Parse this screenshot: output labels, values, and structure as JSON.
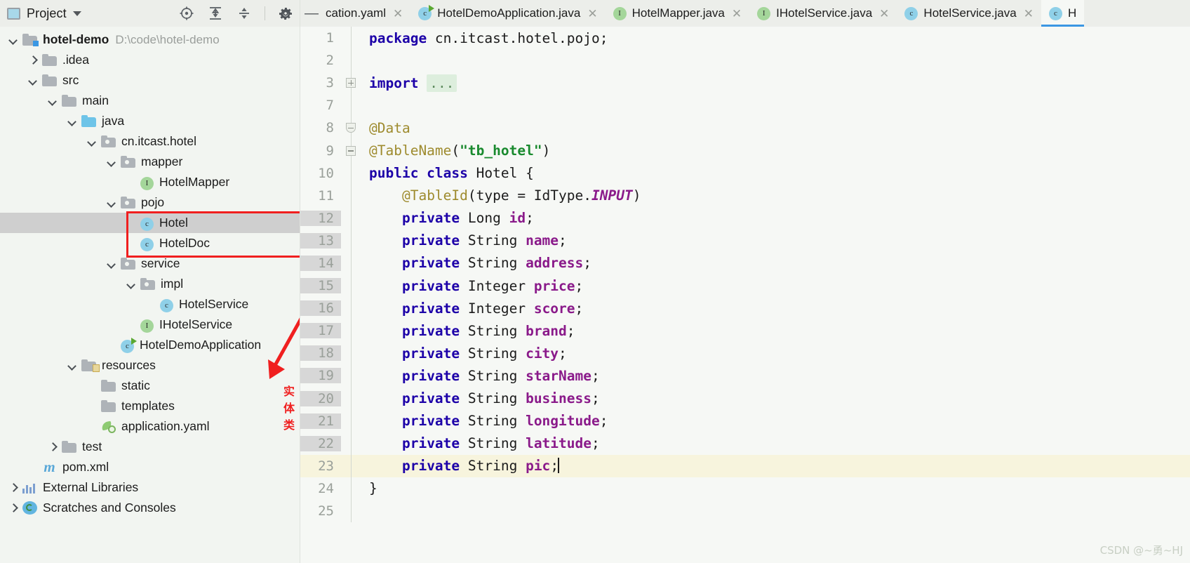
{
  "toolwindow": {
    "title": "Project",
    "icons": [
      "project-icon",
      "chevron-down-icon",
      "locate-icon",
      "expand-all-icon",
      "collapse-all-icon",
      "gear-icon",
      "minimize-icon"
    ]
  },
  "tabs": [
    {
      "label": "cation.yaml",
      "icon": "none",
      "active": false,
      "truncated": true
    },
    {
      "label": "HotelDemoApplication.java",
      "icon": "spring-class-icon",
      "active": false
    },
    {
      "label": "HotelMapper.java",
      "icon": "interface-icon",
      "active": false
    },
    {
      "label": "IHotelService.java",
      "icon": "interface-icon",
      "active": false
    },
    {
      "label": "HotelService.java",
      "icon": "class-icon",
      "active": false
    },
    {
      "label": "H",
      "icon": "class-icon",
      "active": true,
      "truncated": true
    }
  ],
  "tree": [
    {
      "indent": 0,
      "arrow": "down",
      "icon": "module-folder",
      "label": "hotel-demo",
      "bold": true,
      "path": "D:\\code\\hotel-demo"
    },
    {
      "indent": 1,
      "arrow": "right",
      "icon": "folder",
      "label": ".idea"
    },
    {
      "indent": 1,
      "arrow": "down",
      "icon": "folder",
      "label": "src"
    },
    {
      "indent": 2,
      "arrow": "down",
      "icon": "folder",
      "label": "main"
    },
    {
      "indent": 3,
      "arrow": "down",
      "icon": "source-folder",
      "label": "java"
    },
    {
      "indent": 4,
      "arrow": "down",
      "icon": "package-folder",
      "label": "cn.itcast.hotel"
    },
    {
      "indent": 5,
      "arrow": "down",
      "icon": "package-folder",
      "label": "mapper"
    },
    {
      "indent": 6,
      "arrow": "none",
      "icon": "interface-icon",
      "label": "HotelMapper"
    },
    {
      "indent": 5,
      "arrow": "down",
      "icon": "package-folder",
      "label": "pojo"
    },
    {
      "indent": 6,
      "arrow": "none",
      "icon": "class-icon",
      "label": "Hotel",
      "selected": true
    },
    {
      "indent": 6,
      "arrow": "none",
      "icon": "class-icon",
      "label": "HotelDoc"
    },
    {
      "indent": 5,
      "arrow": "down",
      "icon": "package-folder",
      "label": "service"
    },
    {
      "indent": 6,
      "arrow": "down",
      "icon": "package-folder",
      "label": "impl"
    },
    {
      "indent": 7,
      "arrow": "none",
      "icon": "class-icon",
      "label": "HotelService"
    },
    {
      "indent": 6,
      "arrow": "none",
      "icon": "interface-icon",
      "label": "IHotelService"
    },
    {
      "indent": 5,
      "arrow": "none",
      "icon": "spring-class-icon",
      "label": "HotelDemoApplication"
    },
    {
      "indent": 3,
      "arrow": "down",
      "icon": "resource-folder",
      "label": "resources"
    },
    {
      "indent": 4,
      "arrow": "none",
      "icon": "folder",
      "label": "static"
    },
    {
      "indent": 4,
      "arrow": "none",
      "icon": "folder",
      "label": "templates"
    },
    {
      "indent": 4,
      "arrow": "none",
      "icon": "yaml-icon",
      "label": "application.yaml"
    },
    {
      "indent": 2,
      "arrow": "right",
      "icon": "folder",
      "label": "test"
    },
    {
      "indent": 1,
      "arrow": "none",
      "icon": "maven-icon",
      "label": "pom.xml"
    },
    {
      "indent": 0,
      "arrow": "right",
      "icon": "libraries-icon",
      "label": "External Libraries"
    },
    {
      "indent": 0,
      "arrow": "right",
      "icon": "scratches-icon",
      "label": "Scratches and Consoles"
    }
  ],
  "annotation": {
    "note": "实体类",
    "color": "#f01f1f"
  },
  "editor": {
    "lines": [
      {
        "num": "1",
        "fold": "none",
        "current": false,
        "highlight": false
      },
      {
        "num": "2",
        "fold": "none",
        "current": false,
        "highlight": false
      },
      {
        "num": "3",
        "fold": "plus",
        "current": false,
        "highlight": false
      },
      {
        "num": "7",
        "fold": "none",
        "current": false,
        "highlight": false
      },
      {
        "num": "8",
        "fold": "shield",
        "current": false,
        "highlight": false
      },
      {
        "num": "9",
        "fold": "minus",
        "current": false,
        "highlight": false
      },
      {
        "num": "10",
        "fold": "none",
        "current": false,
        "highlight": false
      },
      {
        "num": "11",
        "fold": "none",
        "current": false,
        "highlight": false
      },
      {
        "num": "12",
        "fold": "none",
        "current": true,
        "highlight": false
      },
      {
        "num": "13",
        "fold": "none",
        "current": true,
        "highlight": false
      },
      {
        "num": "14",
        "fold": "none",
        "current": true,
        "highlight": false
      },
      {
        "num": "15",
        "fold": "none",
        "current": true,
        "highlight": false
      },
      {
        "num": "16",
        "fold": "none",
        "current": true,
        "highlight": false
      },
      {
        "num": "17",
        "fold": "none",
        "current": true,
        "highlight": false
      },
      {
        "num": "18",
        "fold": "none",
        "current": true,
        "highlight": false
      },
      {
        "num": "19",
        "fold": "none",
        "current": true,
        "highlight": false
      },
      {
        "num": "20",
        "fold": "none",
        "current": true,
        "highlight": false
      },
      {
        "num": "21",
        "fold": "none",
        "current": true,
        "highlight": false
      },
      {
        "num": "22",
        "fold": "none",
        "current": true,
        "highlight": false
      },
      {
        "num": "23",
        "fold": "none",
        "current": false,
        "highlight": true
      },
      {
        "num": "24",
        "fold": "none",
        "current": false,
        "highlight": false
      },
      {
        "num": "25",
        "fold": "none",
        "current": false,
        "highlight": false
      }
    ],
    "source": [
      "package cn.itcast.hotel.pojo;",
      "",
      "import ...",
      "",
      "@Data",
      "@TableName(\"tb_hotel\")",
      "public class Hotel {",
      "    @TableId(type = IdType.INPUT)",
      "    private Long id;",
      "    private String name;",
      "    private String address;",
      "    private Integer price;",
      "    private Integer score;",
      "    private String brand;",
      "    private String city;",
      "    private String starName;",
      "    private String business;",
      "    private String longitude;",
      "    private String latitude;",
      "    private String pic;",
      "}",
      ""
    ]
  },
  "watermark": "CSDN @~勇~HJ"
}
